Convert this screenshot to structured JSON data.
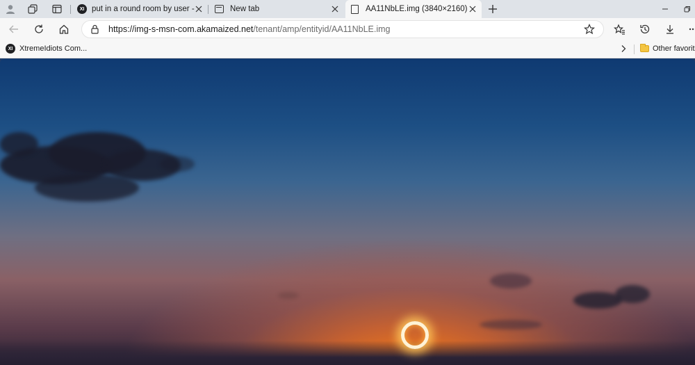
{
  "tabs": [
    {
      "title": "put in a round room by user - Jo",
      "favicon": "xi-icon",
      "active": false
    },
    {
      "title": "New tab",
      "favicon": "newtab-icon",
      "active": false
    },
    {
      "title": "AA11NbLE.img (3840×2160)",
      "favicon": "document-icon",
      "active": true
    }
  ],
  "address": {
    "host": "https://img-s-msn-com.akamaized.net",
    "path": "/tenant/amp/entityid/AA11NbLE.img"
  },
  "favorites": {
    "items": [
      {
        "label": "XtremeIdiots Com...",
        "icon": "xi-icon",
        "icon_text": "XI"
      }
    ],
    "other_label": "Other favorite"
  },
  "colors": {
    "tabstrip_bg": "#dfe3e8",
    "toolbar_bg": "#f7f7f7",
    "sun": "#fff3d6"
  }
}
